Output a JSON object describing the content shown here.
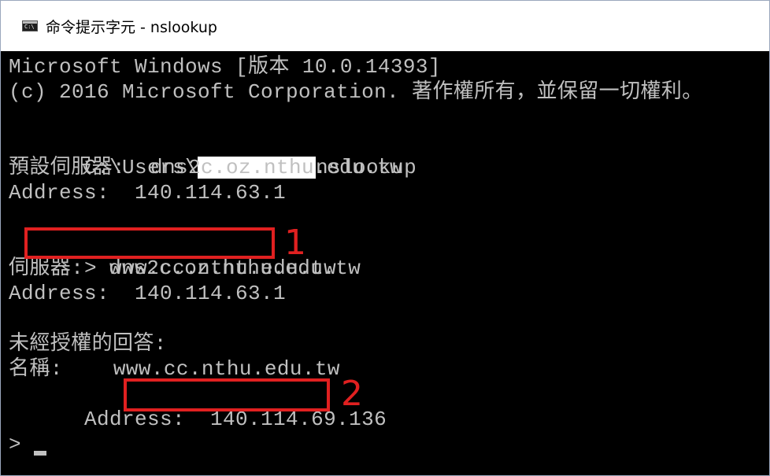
{
  "window": {
    "title": "命令提示字元 - nslookup",
    "icon_glyph": "C:\\"
  },
  "console": {
    "lines": [
      "Microsoft Windows [版本 10.0.14393]",
      "(c) 2016 Microsoft Corporation. 著作權所有，並保留一切權利。",
      "",
      "C:\\Users\\",
      "nslookup",
      "預設伺服器:  dns2c.oz.nthu.edu.tw",
      "Address:  140.114.63.1",
      "",
      "> ",
      "www.cc.nthu.edu.tw",
      "伺服器:  dns2c.oz.nthu.edu.tw",
      "Address:  140.114.63.1",
      "",
      "未經授權的回答:",
      "名稱:    www.cc.nthu.edu.tw",
      "Address:  ",
      "140.114.69.136",
      "",
      "> "
    ]
  },
  "annotations": {
    "label_1": "1",
    "label_2": "2",
    "color": "#e02020"
  },
  "colors": {
    "console_bg": "#000000",
    "console_text": "#c0c0c0",
    "titlebar_bg": "#ffffff"
  }
}
